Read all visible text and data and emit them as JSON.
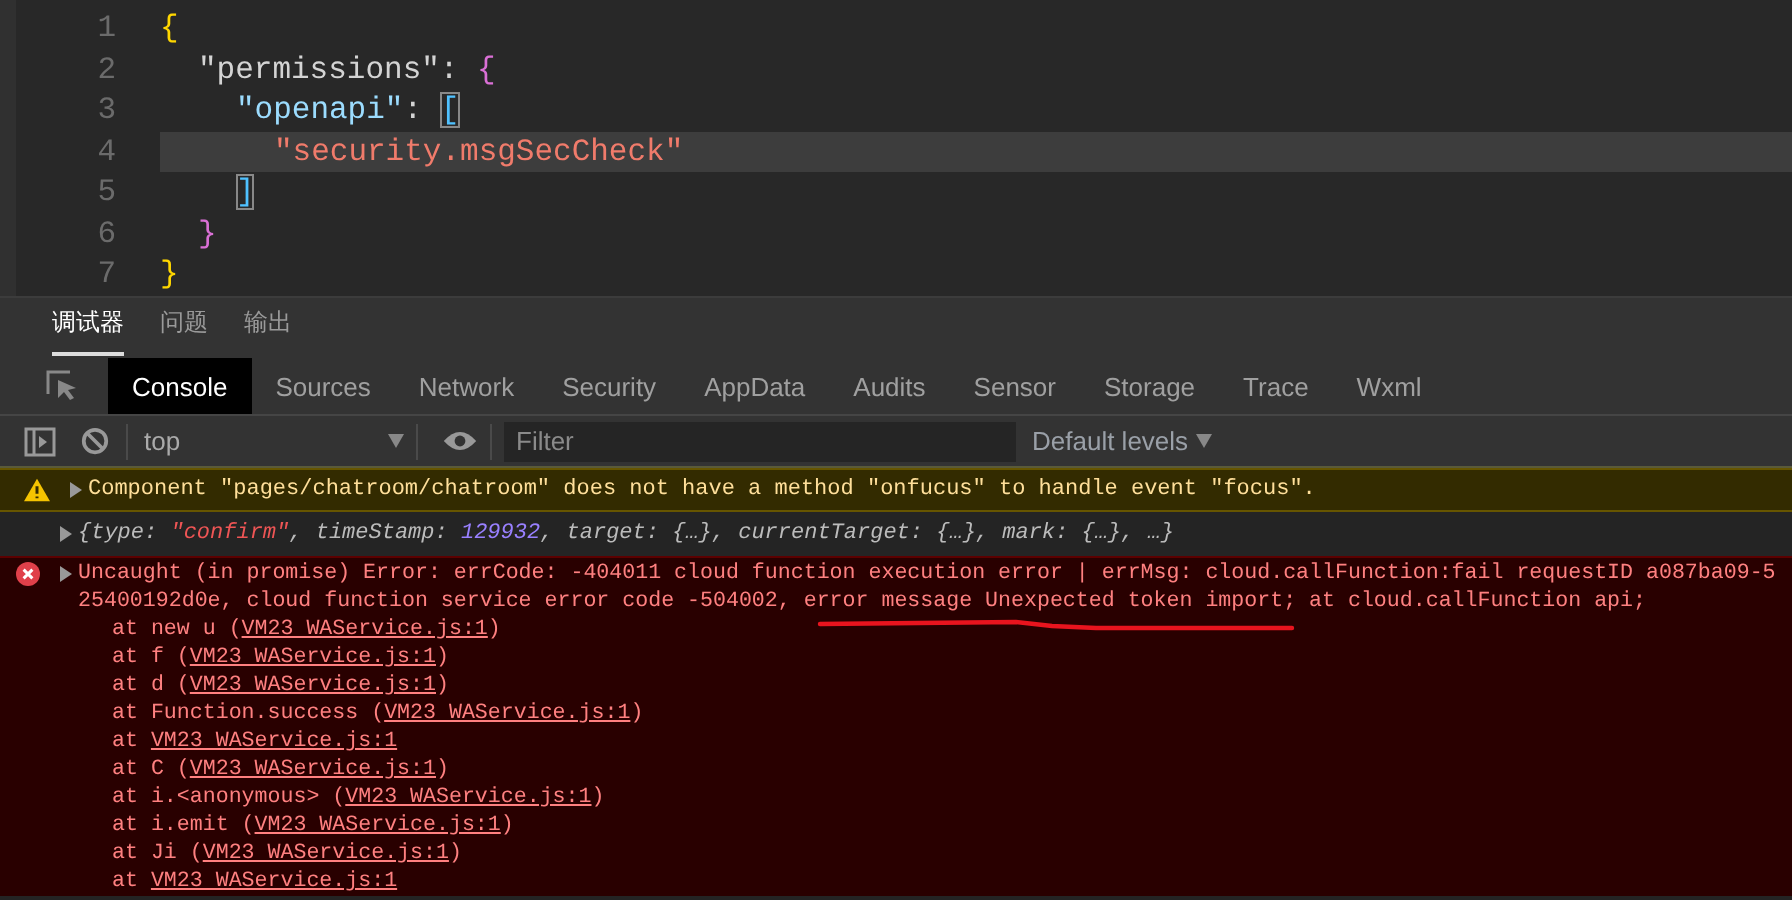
{
  "editor": {
    "lines": [
      {
        "number": "1",
        "highlighted": false,
        "tokens": [
          {
            "text": "{",
            "kind": "brace-gold"
          }
        ],
        "children": [
          {
            "number": "2",
            "highlighted": false,
            "tokens": [
              {
                "text": "\"permissions\"",
                "kind": "key-plain"
              },
              {
                "text": ": ",
                "kind": "punct"
              },
              {
                "text": "{",
                "kind": "brace-pink"
              }
            ],
            "children": [
              {
                "number": "3",
                "highlighted": false,
                "tokens": [
                  {
                    "text": "\"openapi\"",
                    "kind": "key-blue"
                  },
                  {
                    "text": ": ",
                    "kind": "punct"
                  },
                  {
                    "text": "[",
                    "kind": "bracket-match"
                  }
                ],
                "children": [
                  {
                    "number": "4",
                    "highlighted": true,
                    "tokens": [
                      {
                        "text": "\"security.msgSecCheck\"",
                        "kind": "string"
                      }
                    ]
                  }
                ]
              },
              {
                "number": "5",
                "highlighted": false,
                "tokens": [
                  {
                    "text": "]",
                    "kind": "bracket-match"
                  }
                ]
              }
            ]
          },
          {
            "number": "6",
            "highlighted": false,
            "tokens": [
              {
                "text": "}",
                "kind": "brace-pink"
              }
            ]
          }
        ]
      },
      {
        "number": "7",
        "highlighted": false,
        "tokens": [
          {
            "text": "}",
            "kind": "brace-gold"
          }
        ]
      }
    ]
  },
  "drawer_tabs": [
    {
      "label": "调试器",
      "selected": true
    },
    {
      "label": "问题",
      "selected": false
    },
    {
      "label": "输出",
      "selected": false
    }
  ],
  "panel_tabs": [
    {
      "label": "Console",
      "selected": true
    },
    {
      "label": "Sources",
      "selected": false
    },
    {
      "label": "Network",
      "selected": false
    },
    {
      "label": "Security",
      "selected": false
    },
    {
      "label": "AppData",
      "selected": false
    },
    {
      "label": "Audits",
      "selected": false
    },
    {
      "label": "Sensor",
      "selected": false
    },
    {
      "label": "Storage",
      "selected": false
    },
    {
      "label": "Trace",
      "selected": false
    },
    {
      "label": "Wxml",
      "selected": false
    }
  ],
  "console_toolbar": {
    "context": "top",
    "filter": {
      "placeholder": "Filter"
    },
    "levels": "Default levels"
  },
  "messages": [
    {
      "kind": "warning",
      "text": "Component \"pages/chatroom/chatroom\" does not have a method \"onfucus\" to handle event \"focus\"."
    },
    {
      "kind": "object",
      "tokens": [
        {
          "text": "{type: ",
          "kind": "plain"
        },
        {
          "text": "\"confirm\"",
          "kind": "string"
        },
        {
          "text": ", timeStamp: ",
          "kind": "plain"
        },
        {
          "text": "129932",
          "kind": "number"
        },
        {
          "text": ", target: {…}, currentTarget: {…}, mark: {…}, …}",
          "kind": "plain"
        }
      ]
    },
    {
      "kind": "error",
      "text": "Uncaught (in promise) Error: errCode: -404011 cloud function execution error | errMsg: cloud.callFunction:fail requestID a087ba09-525400192d0e, cloud function service error code -504002, error message Unexpected token import; at cloud.callFunction api;",
      "stack": [
        {
          "text": "at new u (",
          "link": "VM23 WAService.js:1",
          "after": ")"
        },
        {
          "text": "at f (",
          "link": "VM23 WAService.js:1",
          "after": ")"
        },
        {
          "text": "at d (",
          "link": "VM23 WAService.js:1",
          "after": ")"
        },
        {
          "text": "at Function.success (",
          "link": "VM23 WAService.js:1",
          "after": ")"
        },
        {
          "text": "at ",
          "link": "VM23 WAService.js:1"
        },
        {
          "text": "at C (",
          "link": "VM23 WAService.js:1",
          "after": ")"
        },
        {
          "text": "at i.<anonymous> (",
          "link": "VM23 WAService.js:1",
          "after": ")"
        },
        {
          "text": "at i.emit (",
          "link": "VM23 WAService.js:1",
          "after": ")"
        },
        {
          "text": "at Ji (",
          "link": "VM23 WAService.js:1",
          "after": ")"
        },
        {
          "text": "at ",
          "link": "VM23 WAService.js:1"
        }
      ]
    }
  ]
}
